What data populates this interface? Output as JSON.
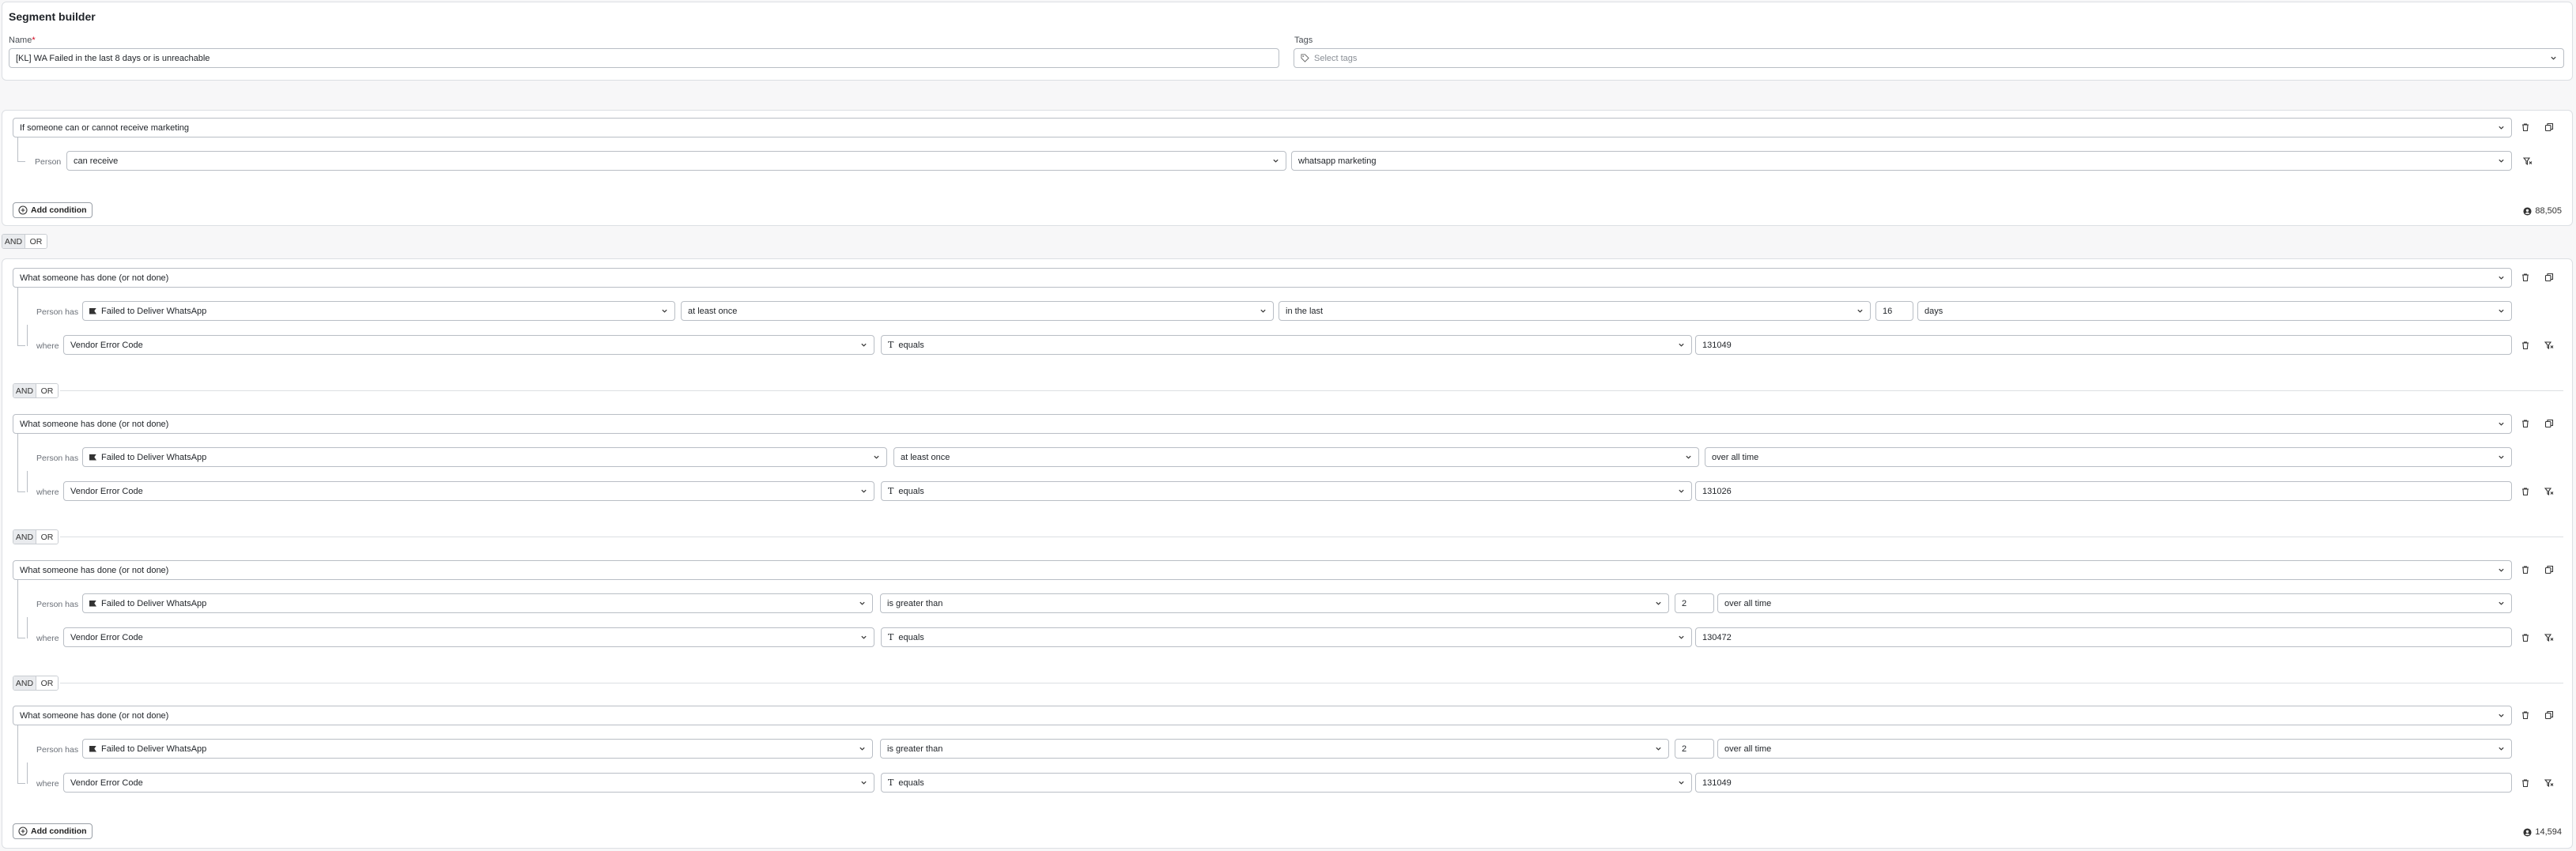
{
  "header": {
    "title": "Segment builder",
    "name_label": "Name",
    "tags_label": "Tags"
  },
  "name_input": {
    "value": "[KL] WA Failed in the last 8 days or is unreachable"
  },
  "tags_select": {
    "placeholder": "Select tags"
  },
  "group1": {
    "type": "If someone can or cannot receive marketing",
    "person_label": "Person",
    "can_receive": "can receive",
    "channel": "whatsapp marketing",
    "add_condition": "Add condition",
    "count": "88,505"
  },
  "top_andor": {
    "and": "AND",
    "or": "OR"
  },
  "group2": {
    "count": "14,594",
    "add_condition": "Add condition",
    "conditions": [
      {
        "type": "What someone has done (or not done)",
        "person_has": "Person has",
        "event": "Failed to Deliver WhatsApp",
        "freq": "at least once",
        "time": "in the last",
        "num": "16",
        "unit": "days",
        "where": "where",
        "prop": "Vendor Error Code",
        "op": "equals",
        "value": "131049"
      },
      {
        "type": "What someone has done (or not done)",
        "person_has": "Person has",
        "event": "Failed to Deliver WhatsApp",
        "freq": "at least once",
        "time": "over all time",
        "where": "where",
        "prop": "Vendor Error Code",
        "op": "equals",
        "value": "131026"
      },
      {
        "type": "What someone has done (or not done)",
        "person_has": "Person has",
        "event": "Failed to Deliver WhatsApp",
        "freq": "is greater than",
        "num": "2",
        "time": "over all time",
        "where": "where",
        "prop": "Vendor Error Code",
        "op": "equals",
        "value": "130472"
      },
      {
        "type": "What someone has done (or not done)",
        "person_has": "Person has",
        "event": "Failed to Deliver WhatsApp",
        "freq": "is greater than",
        "num": "2",
        "time": "over all time",
        "where": "where",
        "prop": "Vendor Error Code",
        "op": "equals",
        "value": "131049"
      }
    ],
    "andor": [
      {
        "and": "AND",
        "or": "OR"
      },
      {
        "and": "AND",
        "or": "OR"
      },
      {
        "and": "AND",
        "or": "OR"
      }
    ]
  },
  "icons": {
    "trash": "trash-icon",
    "copy": "copy-icon",
    "filter": "filter-remove-icon",
    "tag": "tag-icon",
    "person": "person-icon",
    "plus": "plus-circle-icon",
    "chevron": "chevron-down-icon",
    "flag": "flag-icon",
    "text": "text-type-icon"
  }
}
